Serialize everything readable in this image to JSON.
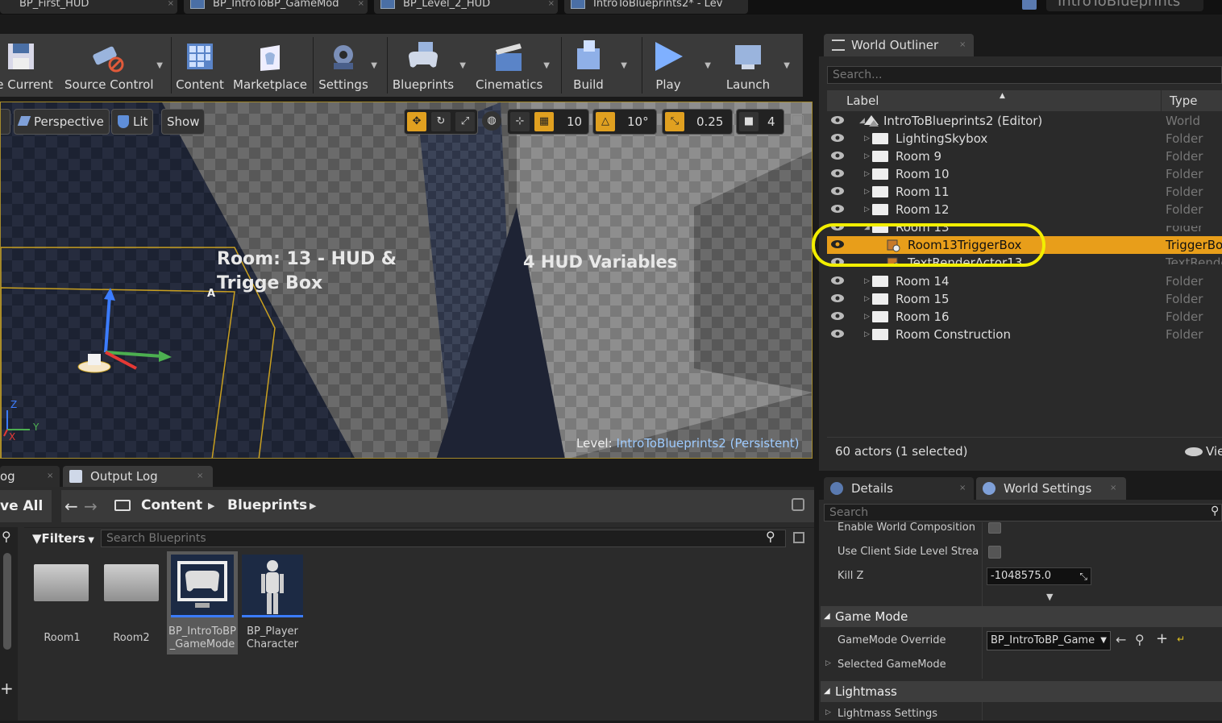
{
  "tabs": [
    {
      "label": "BP_First_HUD"
    },
    {
      "label": "BP_IntroToBP_GameMod"
    },
    {
      "label": "BP_Level_2_HUD"
    },
    {
      "label": "IntroToBlueprints2* - Lev"
    }
  ],
  "app_title": "IntroToBlueprints",
  "toolbar": {
    "buttons": [
      {
        "label": "ve Current",
        "icon": "save-icon"
      },
      {
        "label": "Source Control",
        "icon": "source-control-icon"
      },
      {
        "label": "Content",
        "icon": "content-icon"
      },
      {
        "label": "Marketplace",
        "icon": "marketplace-icon"
      },
      {
        "label": "Settings",
        "icon": "settings-icon"
      },
      {
        "label": "Blueprints",
        "icon": "blueprints-icon"
      },
      {
        "label": "Cinematics",
        "icon": "cinematics-icon"
      },
      {
        "label": "Build",
        "icon": "build-icon"
      },
      {
        "label": "Play",
        "icon": "play-icon"
      },
      {
        "label": "Launch",
        "icon": "launch-icon"
      }
    ]
  },
  "viewport": {
    "perspective_label": "Perspective",
    "lit_label": "Lit",
    "show_label": "Show",
    "grid_snap": "10",
    "rotation_snap": "10°",
    "scale_snap": "0.25",
    "camera_speed": "4",
    "text_room13": "Room: 13 - HUD & Trigge Box",
    "text_hud_variables": "4 HUD Variables",
    "level_prefix": "Level:",
    "level_name": "IntroToBlueprints2 (Persistent)",
    "axis_x": "X",
    "axis_y": "Y",
    "axis_z": "Z",
    "marker_a": "A"
  },
  "outliner": {
    "tab_label": "World Outliner",
    "search_placeholder": "Search...",
    "col_label": "Label",
    "col_type": "Type",
    "rows": [
      {
        "label": "IntroToBlueprints2 (Editor)",
        "type": "World"
      },
      {
        "label": "LightingSkybox",
        "type": "Folder"
      },
      {
        "label": "Room 9",
        "type": "Folder"
      },
      {
        "label": "Room 10",
        "type": "Folder"
      },
      {
        "label": "Room 11",
        "type": "Folder"
      },
      {
        "label": "Room 12",
        "type": "Folder"
      },
      {
        "label": "Room 13",
        "type": "Folder"
      },
      {
        "label": "Room13TriggerBox",
        "type": "TriggerBox"
      },
      {
        "label": "TextRenderActor13",
        "type": "TextRende"
      },
      {
        "label": "Room 14",
        "type": "Folder"
      },
      {
        "label": "Room 15",
        "type": "Folder"
      },
      {
        "label": "Room 16",
        "type": "Folder"
      },
      {
        "label": "Room Construction",
        "type": "Folder"
      }
    ],
    "footer": "60 actors (1 selected)",
    "view_options": "Vie"
  },
  "details": {
    "tab_details": "Details",
    "tab_world_settings": "World Settings",
    "search_placeholder": "Search",
    "enable_world_composition": "Enable World Composition",
    "use_client_side": "Use Client Side Level Strea",
    "kill_z_label": "Kill Z",
    "kill_z_value": "-1048575.0",
    "section_game_mode": "Game Mode",
    "gamemode_override_label": "GameMode Override",
    "gamemode_override_value": "BP_IntroToBP_Game",
    "selected_gamemode": "Selected GameMode",
    "section_lightmass": "Lightmass",
    "lightmass_settings": "Lightmass Settings"
  },
  "content_browser": {
    "tab_log": "og",
    "tab_output_log": "Output Log",
    "save_all": "ve All",
    "path_content": "Content",
    "path_blueprints": "Blueprints",
    "filters_label": "Filters",
    "search_placeholder": "Search Blueprints",
    "assets": [
      {
        "label": "Room1"
      },
      {
        "label": "Room2"
      },
      {
        "label": "BP_IntroToBP _GameMode"
      },
      {
        "label": "BP_Player Character"
      }
    ]
  },
  "colors": {
    "selection": "#e89e1a",
    "highlight_circle": "#f2ee00",
    "link_blue": "#9ecbff"
  }
}
